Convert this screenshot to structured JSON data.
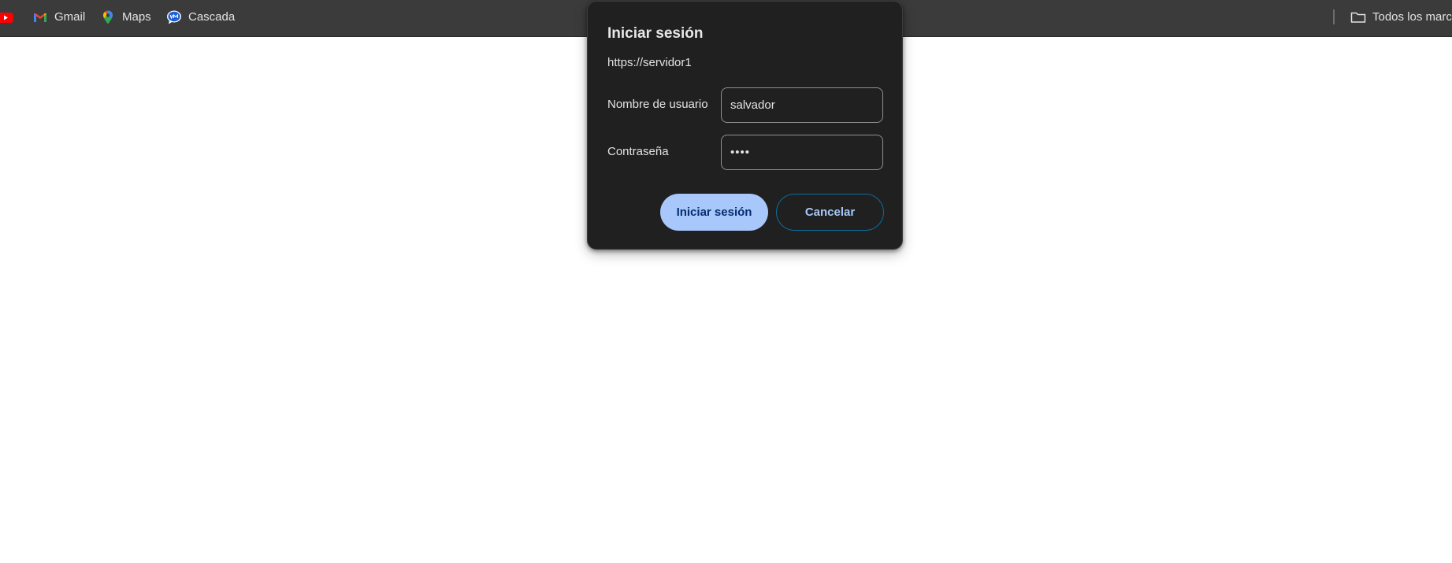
{
  "bookmarks_bar": {
    "items": [
      {
        "label": "",
        "icon": "youtube-icon"
      },
      {
        "label": "Gmail",
        "icon": "gmail-icon"
      },
      {
        "label": "Maps",
        "icon": "maps-pin-icon"
      },
      {
        "label": "Cascada",
        "icon": "chat-bubble-icon"
      }
    ],
    "all_bookmarks": {
      "label": "Todos los marc",
      "icon": "folder-icon"
    }
  },
  "dialog": {
    "title": "Iniciar sesión",
    "url": "https://servidor1",
    "username": {
      "label": "Nombre de usuario",
      "value": "salvador"
    },
    "password": {
      "label": "Contraseña",
      "value": "••••"
    },
    "signin_label": "Iniciar sesión",
    "cancel_label": "Cancelar"
  },
  "colors": {
    "bar_background": "#3b3b3b",
    "dialog_background": "#202020",
    "primary_button": "#a8c7fa",
    "secondary_border": "#0b6e9e"
  }
}
